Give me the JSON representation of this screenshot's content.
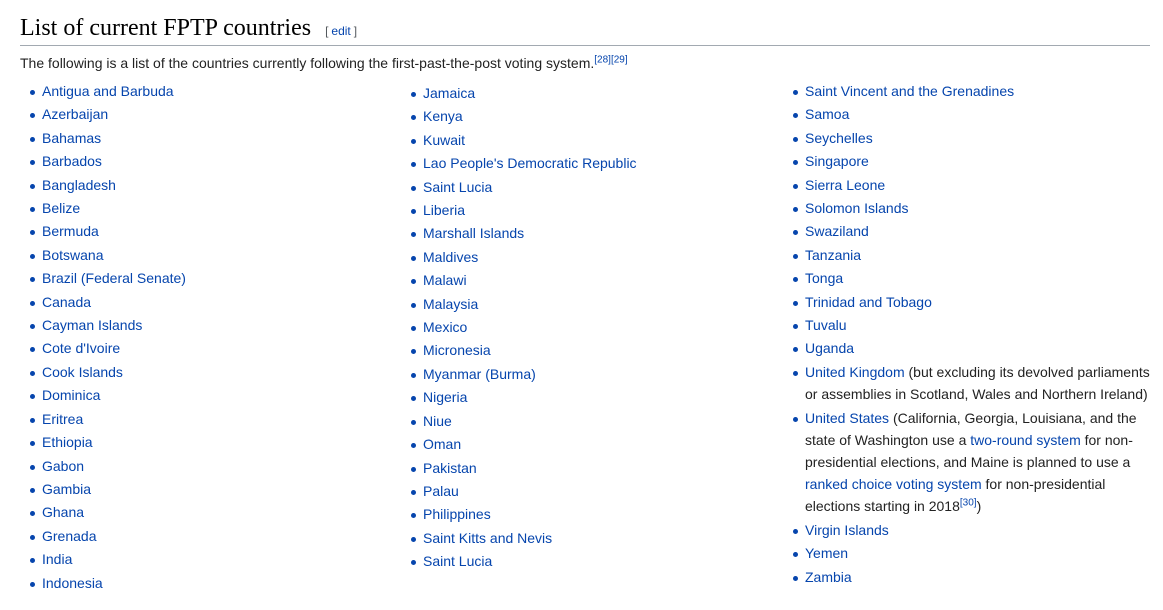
{
  "section": {
    "title": "List of current FPTP countries",
    "edit_open": "[",
    "edit_label": "edit",
    "edit_close": "]"
  },
  "intro": {
    "text": "The following is a list of the countries currently following the first-past-the-post voting system.",
    "ref1": "[28]",
    "ref2": "[29]"
  },
  "columns": {
    "col1": [
      "Antigua and Barbuda",
      "Azerbaijan",
      "Bahamas",
      "Barbados",
      "Bangladesh",
      "Belize",
      "Bermuda",
      "Botswana",
      "Brazil (Federal Senate)",
      "Canada",
      "Cayman Islands",
      "Cote d'Ivoire",
      "Cook Islands",
      "Dominica",
      "Eritrea",
      "Ethiopia",
      "Gabon",
      "Gambia",
      "Ghana",
      "Grenada",
      "India",
      "Indonesia"
    ],
    "col2": [
      "Jamaica",
      "Kenya",
      "Kuwait",
      "Lao People's Democratic Republic",
      "Saint Lucia",
      "Liberia",
      "Marshall Islands",
      "Maldives",
      "Malawi",
      "Malaysia",
      "Mexico",
      "Micronesia",
      "Myanmar (Burma)",
      "Nigeria",
      "Niue",
      "Oman",
      "Pakistan",
      "Palau",
      "Philippines",
      "Saint Kitts and Nevis",
      "Saint Lucia"
    ],
    "col3_before": [
      "Saint Vincent and the Grenadines",
      "Samoa",
      "Seychelles",
      "Singapore",
      "Sierra Leone",
      "Solomon Islands",
      "Swaziland",
      "Tanzania",
      "Tonga",
      "Trinidad and Tobago",
      "Tuvalu",
      "Uganda"
    ],
    "uk": {
      "link": "United Kingdom",
      "note": " (but excluding its devolved parliaments or assemblies in Scotland, Wales and Northern Ireland)"
    },
    "us": {
      "link": "United States",
      "text1": " (California, Georgia, Louisiana, and the state of Washington use a ",
      "link2": "two-round system",
      "text2": " for non-presidential elections, and Maine is planned to use a ",
      "link3": "ranked choice voting system",
      "text3": " for non-presidential elections starting in 2018",
      "ref": "[30]",
      "close": ")"
    },
    "col3_after": [
      "Virgin Islands",
      "Yemen",
      "Zambia"
    ]
  }
}
